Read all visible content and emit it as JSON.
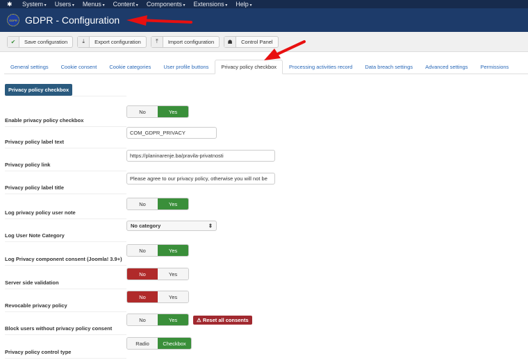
{
  "topnav": {
    "items": [
      "System",
      "Users",
      "Menus",
      "Content",
      "Components",
      "Extensions",
      "Help"
    ]
  },
  "header": {
    "title": "GDPR - Configuration",
    "logo_text": "GDPR"
  },
  "toolbar": {
    "save": "Save configuration",
    "export": "Export configuration",
    "import": "Import configuration",
    "control_panel": "Control Panel"
  },
  "tabs": [
    "General settings",
    "Cookie consent",
    "Cookie categories",
    "User profile buttons",
    "Privacy policy checkbox",
    "Processing activities record",
    "Data breach settings",
    "Advanced settings",
    "Permissions"
  ],
  "section": {
    "title": "Privacy policy checkbox"
  },
  "fields": [
    {
      "label": "Enable privacy policy checkbox",
      "options": [
        "No",
        "Yes"
      ],
      "selected": "Yes"
    },
    {
      "label": "Privacy policy label text",
      "value": "COM_GDPR_PRIVACY"
    },
    {
      "label": "Privacy policy link",
      "value": "https://planinarenje.ba/pravila-privatnosti"
    },
    {
      "label": "Privacy policy label title",
      "value": "Please agree to our privacy policy, otherwise you will not be"
    },
    {
      "label": "Log privacy policy user note",
      "options": [
        "No",
        "Yes"
      ],
      "selected": "Yes"
    },
    {
      "label": "Log User Note Category",
      "value": "No category"
    },
    {
      "label": "Log Privacy component consent (Joomla! 3.9+)",
      "options": [
        "No",
        "Yes"
      ],
      "selected": "Yes"
    },
    {
      "label": "Server side validation",
      "options": [
        "No",
        "Yes"
      ],
      "selected": "No"
    },
    {
      "label": "Revocable privacy policy",
      "options": [
        "No",
        "Yes"
      ],
      "selected": "No"
    },
    {
      "label": "Block users without privacy policy consent",
      "options": [
        "No",
        "Yes"
      ],
      "selected": "Yes",
      "extra_button": "Reset all consents"
    },
    {
      "label": "Privacy policy control type",
      "options": [
        "Radio",
        "Checkbox"
      ],
      "selected": "Checkbox"
    }
  ]
}
